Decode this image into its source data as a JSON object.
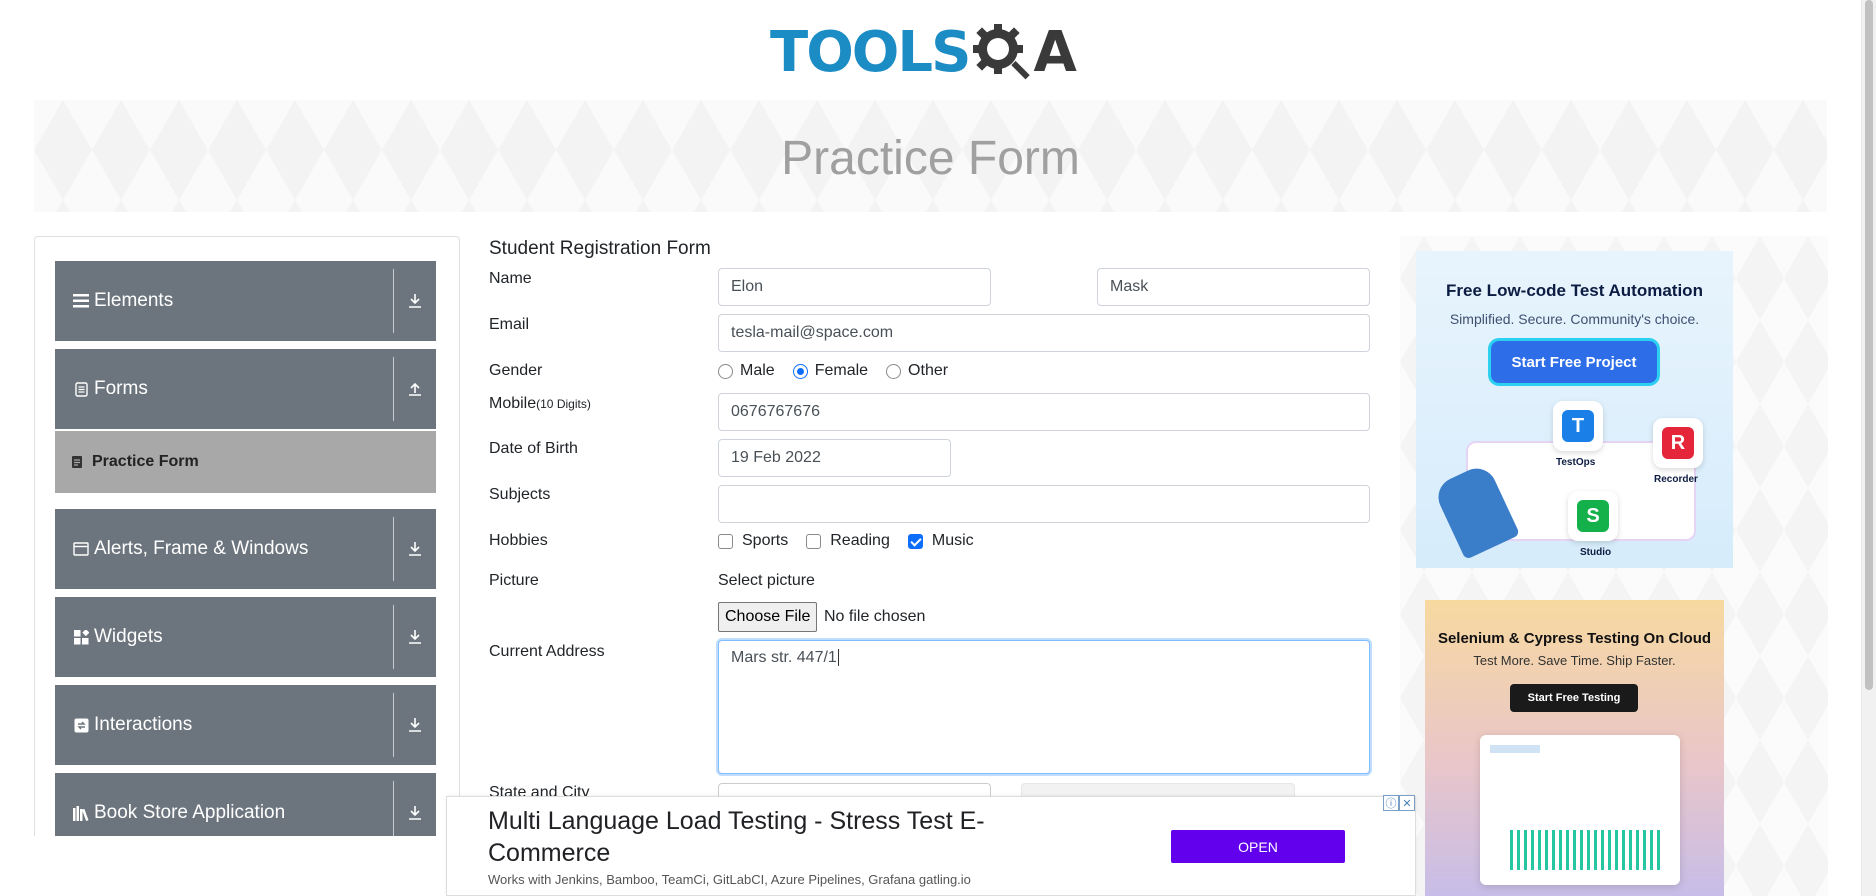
{
  "header": {
    "logo_text": "TOOLS",
    "logo_a": "A",
    "page_title": "Practice Form"
  },
  "sidebar": {
    "groups": [
      {
        "label": "Elements",
        "icon": "menu-icon",
        "arrow": "download-icon"
      },
      {
        "label": "Forms",
        "icon": "document-icon",
        "arrow": "upload-icon"
      },
      {
        "label": "Alerts, Frame & Windows",
        "icon": "window-icon",
        "arrow": "download-icon"
      },
      {
        "label": "Widgets",
        "icon": "widgets-icon",
        "arrow": "download-icon"
      },
      {
        "label": "Interactions",
        "icon": "interactions-icon",
        "arrow": "download-icon"
      },
      {
        "label": "Book Store Application",
        "icon": "books-icon",
        "arrow": "download-icon"
      }
    ],
    "active_item": "Practice Form"
  },
  "form": {
    "title": "Student Registration Form",
    "labels": {
      "name": "Name",
      "email": "Email",
      "gender": "Gender",
      "mobile": "Mobile",
      "mobile_hint": "(10 Digits)",
      "dob": "Date of Birth",
      "subjects": "Subjects",
      "hobbies": "Hobbies",
      "picture": "Picture",
      "address": "Current Address",
      "state_city": "State and City"
    },
    "first_name": "Elon",
    "last_name": "Mask",
    "email": "tesla-mail@space.com",
    "gender_options": [
      "Male",
      "Female",
      "Other"
    ],
    "gender_selected": "Female",
    "mobile": "0676767676",
    "dob": "19 Feb 2022",
    "subjects": "",
    "hobbies": [
      {
        "label": "Sports",
        "checked": false
      },
      {
        "label": "Reading",
        "checked": false
      },
      {
        "label": "Music",
        "checked": true
      }
    ],
    "picture_label": "Select picture",
    "choose_file": "Choose File",
    "no_file": "No file chosen",
    "address": "Mars str. 447/1"
  },
  "ads": {
    "ad1": {
      "title": "Free Low-code Test Automation",
      "subtitle": "Simplified. Secure. Community's choice.",
      "button": "Start Free Project",
      "tiles": [
        "TestOps",
        "Recorder",
        "Studio"
      ]
    },
    "ad2": {
      "title": "Selenium & Cypress Testing On Cloud",
      "subtitle": "Test More. Save Time. Ship Faster.",
      "button": "Start Free Testing"
    },
    "bottom": {
      "headline": "Multi Language Load Testing - Stress Test E-Commerce",
      "description": "Works with Jenkins, Bamboo, TeamCi, GitLabCI, Azure Pipelines, Grafana gatling.io",
      "button": "OPEN"
    }
  },
  "colors": {
    "sidebar_group": "#6c757d",
    "sidebar_active": "#a8a8a8",
    "accent": "#0d6efd",
    "open_button": "#6200ee",
    "logo_blue": "#1b8cc4"
  }
}
